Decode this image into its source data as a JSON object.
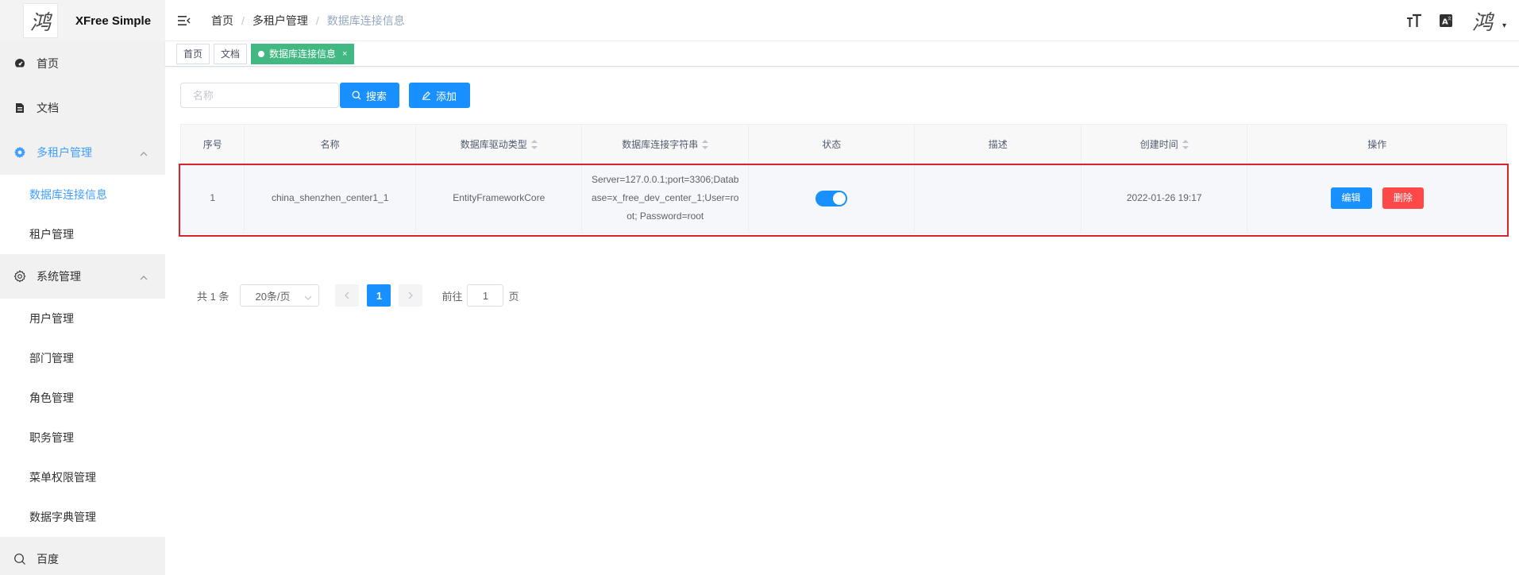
{
  "app": {
    "title": "XFree Simple",
    "logo_glyph": "鸿"
  },
  "sidebar": {
    "items": [
      {
        "label": "首页",
        "icon": "dashboard-icon"
      },
      {
        "label": "文档",
        "icon": "document-icon"
      },
      {
        "label": "多租户管理",
        "icon": "gear-icon",
        "expanded": true,
        "children": [
          {
            "label": "数据库连接信息",
            "active": true
          },
          {
            "label": "租户管理"
          }
        ]
      },
      {
        "label": "系统管理",
        "icon": "settings-icon",
        "expanded": true,
        "children": [
          {
            "label": "用户管理"
          },
          {
            "label": "部门管理"
          },
          {
            "label": "角色管理"
          },
          {
            "label": "职务管理"
          },
          {
            "label": "菜单权限管理"
          },
          {
            "label": "数据字典管理"
          }
        ]
      },
      {
        "label": "百度",
        "icon": "search-icon"
      }
    ]
  },
  "header": {
    "breadcrumb": [
      "首页",
      "多租户管理",
      "数据库连接信息"
    ],
    "separator": "/",
    "avatar_glyph": "鸿"
  },
  "tags": [
    {
      "label": "首页"
    },
    {
      "label": "文档"
    },
    {
      "label": "数据库连接信息",
      "active": true,
      "close": "×"
    }
  ],
  "toolbar": {
    "search_placeholder": "名称",
    "search_label": "搜索",
    "add_label": "添加"
  },
  "table": {
    "columns": [
      "序号",
      "名称",
      "数据库驱动类型",
      "数据库连接字符串",
      "状态",
      "描述",
      "创建时间",
      "操作"
    ],
    "rows": [
      {
        "index": "1",
        "name": "china_shenzhen_center1_1",
        "driver": "EntityFrameworkCore",
        "connection": "Server=127.0.0.1;port=3306;Database=x_free_dev_center_1;User=root; Password=root",
        "status_on": true,
        "description": "",
        "created": "2022-01-26 19:17",
        "edit_label": "编辑",
        "delete_label": "删除"
      }
    ]
  },
  "pagination": {
    "total_text": "共 1 条",
    "page_size": "20条/页",
    "current_page": "1",
    "goto_prefix": "前往",
    "goto_value": "1",
    "goto_suffix": "页"
  },
  "colors": {
    "primary": "#1890ff",
    "danger": "#ff4949",
    "tag_active": "#42b983",
    "highlight": "#d9232d"
  }
}
